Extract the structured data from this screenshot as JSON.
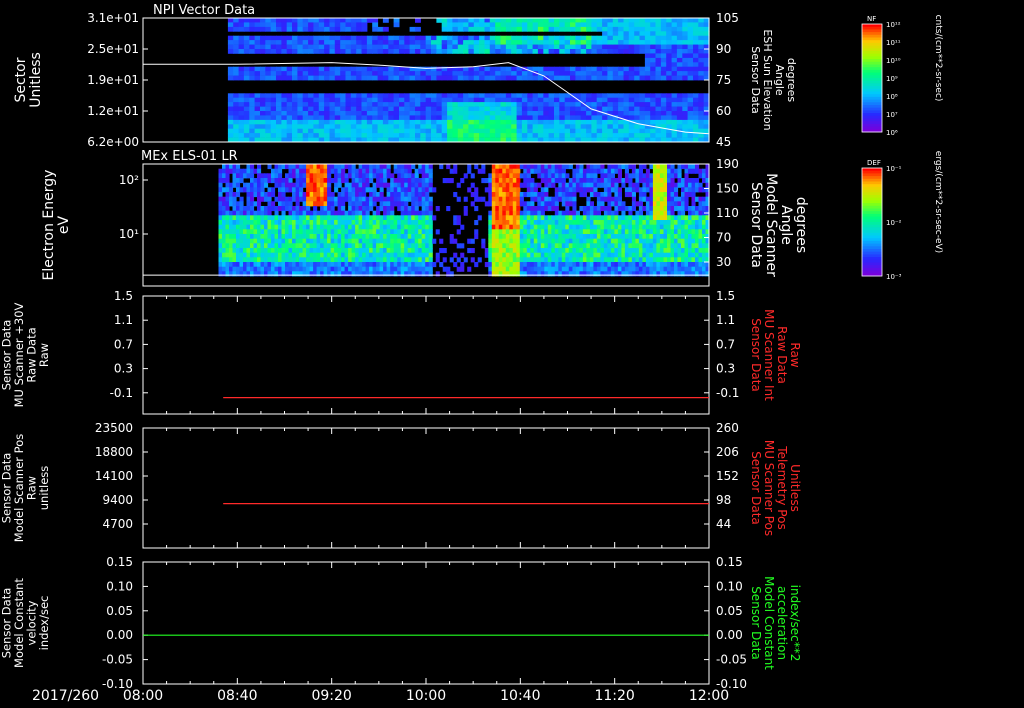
{
  "chart_data": {
    "type": "multi-panel time series",
    "date_label": "2017/260",
    "time_ticks": [
      "08:00",
      "08:40",
      "09:20",
      "10:00",
      "10:40",
      "11:20",
      "12:00"
    ],
    "panels": [
      {
        "id": "npi",
        "type": "heatmap",
        "title": "NPI Vector Data",
        "ylabel": [
          "Sector",
          "Unitless"
        ],
        "left_ticks": [
          "3.1e+01",
          "2.5e+01",
          "1.9e+01",
          "1.2e+01",
          "6.2e+00"
        ],
        "right_ticks": [
          "105",
          "90",
          "75",
          "60",
          "45"
        ],
        "right_label": [
          "Sensor Data",
          "ESH Sun Elevation",
          "Angle",
          "degrees"
        ],
        "right_label_color": "#ffffff",
        "overlay_series": {
          "name": "ESH Sun Elevation Angle",
          "color": "#ffffff",
          "x": [
            "08:00",
            "08:40",
            "09:20",
            "09:40",
            "10:00",
            "10:20",
            "10:35",
            "10:50",
            "11:00",
            "11:10",
            "11:30",
            "11:50",
            "12:00"
          ],
          "values": [
            77,
            77,
            78,
            76.5,
            74.5,
            75.5,
            78,
            70,
            60,
            50,
            41,
            36,
            35
          ],
          "range": [
            30,
            105
          ]
        },
        "heat_rows": 31,
        "data_start": "08:36"
      },
      {
        "id": "els",
        "type": "heatmap",
        "title": "MEx ELS-01 LR",
        "ylabel": [
          "Electron Energy",
          "eV"
        ],
        "left_ticks": [
          "10²",
          "10¹"
        ],
        "right_ticks": [
          "190",
          "150",
          "110",
          "70",
          "30"
        ],
        "right_label": [
          "Sensor Data",
          "Model Scanner",
          "Angle",
          "degrees"
        ],
        "right_label_color": "#ffffff",
        "overlay_series": {
          "name": "Model Scanner Angle",
          "color": "#ffffff",
          "constant": 17,
          "range": [
            0,
            190
          ]
        },
        "data_start": "08:32"
      },
      {
        "id": "mu_raw",
        "type": "line",
        "left_ticks": [
          "1.5",
          "1.1",
          "0.7",
          "0.3",
          "-0.1"
        ],
        "right_ticks": [
          "1.5",
          "1.1",
          "0.7",
          "0.3",
          "-0.1"
        ],
        "ylabel": [
          "Sensor Data",
          "MU Scanner +30V",
          "Raw Data",
          "Raw"
        ],
        "ylim": [
          -0.3,
          1.5
        ],
        "right_label": [
          "Sensor Data",
          "MU Scanner Int",
          "Raw Data",
          "Raw"
        ],
        "right_label_color": "#ff2a2a",
        "series": [
          {
            "color": "#ff2a2a",
            "x": [
              "08:34",
              "12:00"
            ],
            "values": [
              -0.05,
              -0.05
            ]
          }
        ]
      },
      {
        "id": "mu_pos",
        "type": "line",
        "left_ticks": [
          "23500",
          "18800",
          "14100",
          "9400",
          "4700"
        ],
        "right_ticks": [
          "260",
          "206",
          "152",
          "98",
          "44"
        ],
        "ylabel": [
          "Sensor Data",
          "Model Scanner Pos",
          "Raw",
          "unitless"
        ],
        "ylim": [
          0,
          23500
        ],
        "right_label": [
          "Sensor Data",
          "MU Scanner Pos",
          "Telemetry Pos",
          "Unitless"
        ],
        "right_label_color": "#ff2a2a",
        "series": [
          {
            "color": "#ff2a2a",
            "x": [
              "08:34",
              "12:00"
            ],
            "values": [
              8700,
              8700
            ]
          }
        ]
      },
      {
        "id": "model_const",
        "type": "line",
        "left_ticks": [
          "0.15",
          "0.10",
          "0.05",
          "0.00",
          "-0.05",
          "-0.10"
        ],
        "right_ticks": [
          "0.15",
          "0.10",
          "0.05",
          "0.00",
          "-0.05",
          "-0.10"
        ],
        "ylabel": [
          "Sensor Data",
          "Model Constant",
          "velocity",
          "index/sec"
        ],
        "ylim": [
          -0.1,
          0.15
        ],
        "right_label": [
          "Sensor Data",
          "Model Constant",
          "acceleration",
          "index/sec**2"
        ],
        "right_label_color": "#22ff22",
        "series": [
          {
            "color": "#22ff22",
            "x": [
              "08:00",
              "12:00"
            ],
            "values": [
              0.0,
              0.0
            ]
          }
        ]
      }
    ],
    "colorbars": [
      {
        "label": "NF",
        "unit": "cnts/(cm**2-sr-sec)",
        "ticks": [
          "10¹²",
          "10¹¹",
          "10¹⁰",
          "10⁹",
          "10⁸",
          "10⁷",
          "10⁶"
        ]
      },
      {
        "label": "DEF",
        "unit": "ergs/(cm**2-sr-sec-eV)",
        "ticks": [
          "10⁻¹",
          "10⁻²",
          "10⁻³"
        ]
      }
    ]
  }
}
